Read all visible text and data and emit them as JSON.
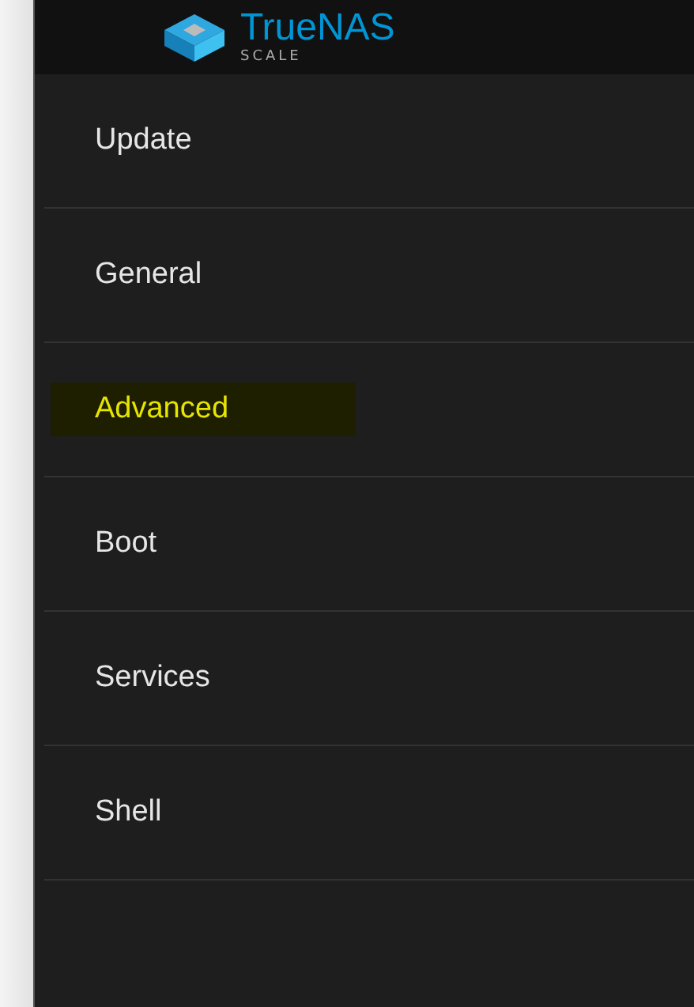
{
  "header": {
    "logo_text": "TrueNAS",
    "logo_subtext": "SCALE"
  },
  "menu": [
    {
      "label": "Update",
      "selected": false
    },
    {
      "label": "General",
      "selected": false
    },
    {
      "label": "Advanced",
      "selected": true
    },
    {
      "label": "Boot",
      "selected": false
    },
    {
      "label": "Services",
      "selected": false
    },
    {
      "label": "Shell",
      "selected": false
    }
  ]
}
